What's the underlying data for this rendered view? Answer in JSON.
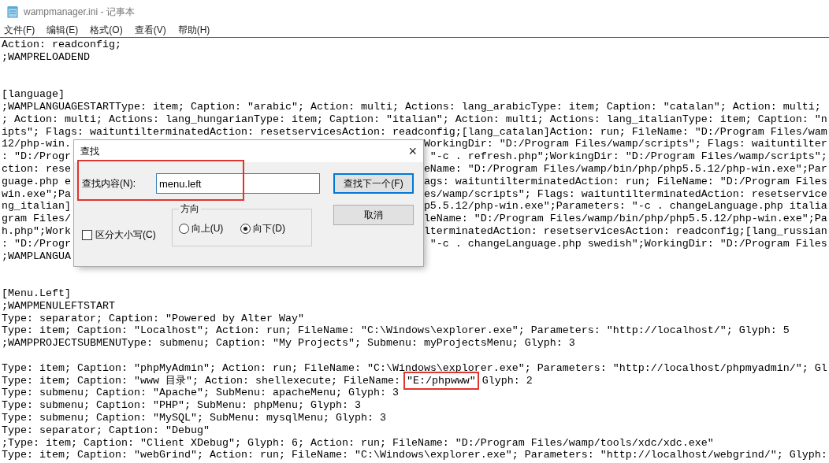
{
  "window": {
    "title": "wampmanager.ini - 记事本"
  },
  "menu": [
    "文件(F)",
    "编辑(E)",
    "格式(O)",
    "查看(V)",
    "帮助(H)"
  ],
  "editor": {
    "lines": [
      {
        "kind": "plain",
        "text": "Action: readconfig;"
      },
      {
        "kind": "plain",
        "text": ";WAMPRELOADEND"
      },
      {
        "kind": "blank"
      },
      {
        "kind": "blank"
      },
      {
        "kind": "plain",
        "text": "[language]"
      },
      {
        "kind": "plain",
        "text": ";WAMPLANGUAGESTARTType: item; Caption: \"arabic\"; Action: multi; Actions: lang_arabicType: item; Caption: \"catalan\"; Action: multi;"
      },
      {
        "kind": "plain",
        "text": "; Action: multi; Actions: lang_hungarianType: item; Caption: \"italian\"; Action: multi; Actions: lang_italianType: item; Caption: \"n"
      },
      {
        "kind": "plain",
        "text": "ipts\"; Flags: waituntilterminatedAction: resetservicesAction: readconfig;[lang_catalan]Action: run; FileName: \"D:/Program Files/wam"
      },
      {
        "kind": "split",
        "left": "12/php-win.",
        "right": "WorkingDir: \"D:/Program Files/wamp/scripts\"; Flags: waituntilter"
      },
      {
        "kind": "split",
        "left": ": \"D:/Progr",
        "right": " \"-c . refresh.php\";WorkingDir: \"D:/Program Files/wamp/scripts\";"
      },
      {
        "kind": "split",
        "left": "ction: rese",
        "right": "eName: \"D:/Program Files/wamp/bin/php/php5.5.12/php-win.exe\";Par"
      },
      {
        "kind": "split",
        "left": "guage.php e",
        "right": "ags: waituntilterminatedAction: run; FileName: \"D:/Program Files"
      },
      {
        "kind": "split",
        "left": "win.exe\";Pa",
        "right": "es/wamp/scripts\"; Flags: waituntilterminatedAction: resetservice"
      },
      {
        "kind": "split",
        "left": "ng_italian]",
        "right": "p5.5.12/php-win.exe\";Parameters: \"-c . changeLanguage.php italia"
      },
      {
        "kind": "split",
        "left": "gram Files/",
        "right": "leName: \"D:/Program Files/wamp/bin/php/php5.5.12/php-win.exe\";Pa"
      },
      {
        "kind": "split",
        "left": "h.php\";Work",
        "right": "lterminatedAction: resetservicesAction: readconfig;[lang_russian"
      },
      {
        "kind": "split",
        "left": ": \"D:/Progr",
        "right": " \"-c . changeLanguage.php swedish\";WorkingDir: \"D:/Program Files"
      },
      {
        "kind": "split",
        "left": ";WAMPLANGUA"
      },
      {
        "kind": "blank"
      },
      {
        "kind": "blank"
      },
      {
        "kind": "plain",
        "text": "[Menu.Left]"
      },
      {
        "kind": "plain",
        "text": ";WAMPMENULEFTSTART"
      },
      {
        "kind": "plain",
        "text": "Type: separator; Caption: \"Powered by Alter Way\""
      },
      {
        "kind": "plain",
        "text": "Type: item; Caption: \"Localhost\"; Action: run; FileName: \"C:\\Windows\\explorer.exe\"; Parameters: \"http://localhost/\"; Glyph: 5"
      },
      {
        "kind": "plain",
        "text": ";WAMPPROJECTSUBMENUType: submenu; Caption: \"My Projects\"; Submenu: myProjectsMenu; Glyph: 3"
      },
      {
        "kind": "blank"
      },
      {
        "kind": "plain",
        "text": "Type: item; Caption: \"phpMyAdmin\"; Action: run; FileName: \"C:\\Windows\\explorer.exe\"; Parameters: \"http://localhost/phpmyadmin/\"; Gl"
      },
      {
        "kind": "marked",
        "before": "Type: item; Caption: \"www 目录\"; Action: shellexecute; FileName: ",
        "mark": "\"E:/phpwww\"",
        "after": " Glyph: 2"
      },
      {
        "kind": "plain",
        "text": "Type: submenu; Caption: \"Apache\"; SubMenu: apacheMenu; Glyph: 3"
      },
      {
        "kind": "plain",
        "text": "Type: submenu; Caption: \"PHP\"; SubMenu: phpMenu; Glyph: 3"
      },
      {
        "kind": "plain",
        "text": "Type: submenu; Caption: \"MySQL\"; SubMenu: mysqlMenu; Glyph: 3"
      },
      {
        "kind": "plain",
        "text": "Type: separator; Caption: \"Debug\""
      },
      {
        "kind": "plain",
        "text": ";Type: item; Caption: \"Client XDebug\"; Glyph: 6; Action: run; FileName: \"D:/Program Files/wamp/tools/xdc/xdc.exe\""
      },
      {
        "kind": "plain",
        "text": "Type: item; Caption: \"webGrind\"; Action: run; FileName: \"C:\\Windows\\explorer.exe\"; Parameters: \"http://localhost/webgrind/\"; Glyph:"
      }
    ]
  },
  "find_dialog": {
    "title": "查找",
    "close": "×",
    "label": "查找内容(N):",
    "value": "menu.left",
    "highlight": true,
    "match_case": {
      "label": "区分大小写(C)",
      "checked": false
    },
    "direction": {
      "legend": "方向",
      "options": [
        {
          "label": "向上(U)",
          "selected": false
        },
        {
          "label": "向下(D)",
          "selected": true
        }
      ]
    },
    "buttons": [
      {
        "label": "查找下一个(F)",
        "default": true
      },
      {
        "label": "取消",
        "default": false
      }
    ]
  }
}
